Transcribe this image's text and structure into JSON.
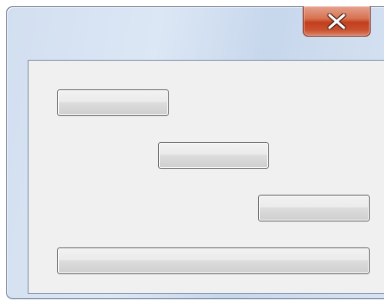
{
  "window": {
    "title": "",
    "close_icon": "close-x-icon"
  },
  "buttons": [
    {
      "label": ""
    },
    {
      "label": ""
    },
    {
      "label": ""
    },
    {
      "label": ""
    }
  ],
  "colors": {
    "close_button": "#c8472a",
    "client_background": "#f0f0f0",
    "frame": "#d2dff0"
  }
}
